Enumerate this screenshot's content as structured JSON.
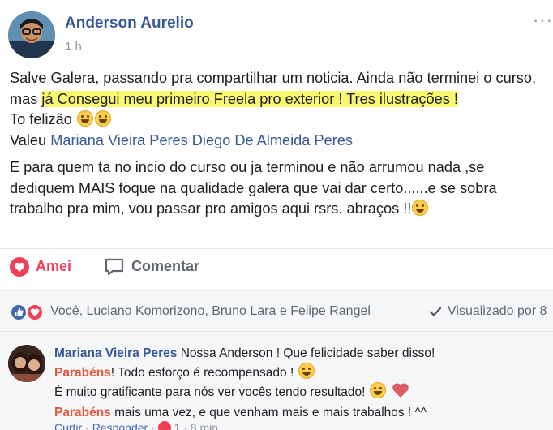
{
  "post": {
    "author": "Anderson Aurelio",
    "time": "1 h",
    "more_label": "···",
    "body": {
      "line1_a": "Salve Galera, passando pra compartilhar um noticia. Ainda não terminei o curso, mas ",
      "line1_highlight": "já Consegui meu primeiro Freela pro exterior ! Tres ilustrações !",
      "line2": "To felizão",
      "line3_prefix": "Valeu ",
      "mention1": "Mariana Vieira Peres",
      "mention2": "Diego De Almeida Peres",
      "paragraph2": "E para quem ta no incio do curso ou ja terminou e não arrumou nada ,se dediquem MAIS foque na qualidade galera que vai dar certo......e se sobra trabalho pra mim, vou passar pro amigos aqui rsrs. abraços !!"
    }
  },
  "actions": {
    "like_label": "Amei",
    "comment_label": "Comentar"
  },
  "reactions": {
    "names": "Você, Luciano Komorizono, Bruno Lara e Felipe Rangel",
    "seen_label": "Visualizado por 8"
  },
  "comment": {
    "author": "Mariana Vieira Peres",
    "text1": "Nossa Anderson ! Que felicidade saber disso!",
    "tag": "Parabéns",
    "text2": "! Todo esforço é recompensado !",
    "text3": "É muito gratificante para nós ver vocês tendo resultado!",
    "text4": " mais uma vez, e que venham mais e mais trabalhos ! ^^",
    "footer": {
      "like": "Curtir",
      "reply": "Responder",
      "count": "1",
      "time": "8 min"
    }
  },
  "colors": {
    "link": "#365899",
    "love": "#f33e58",
    "highlight": "#f9f871",
    "tag": "#e8553a"
  }
}
